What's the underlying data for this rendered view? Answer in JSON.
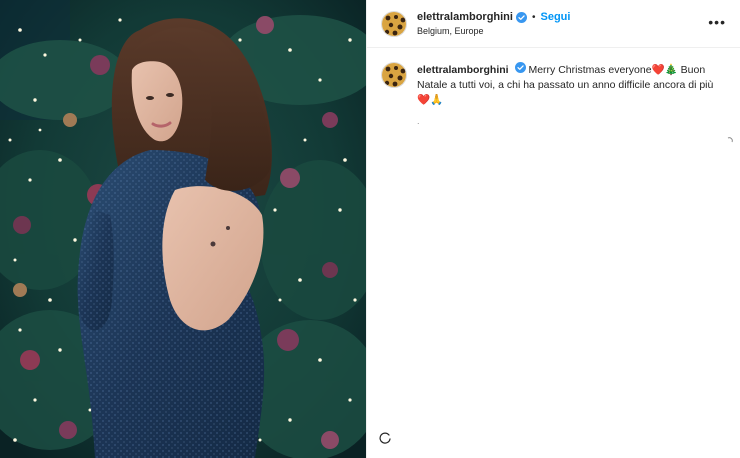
{
  "post": {
    "author": {
      "username": "elettralamborghini",
      "verified": true,
      "avatar_icon": "leopard-avatar-icon"
    },
    "follow_label": "Segui",
    "separator": "•",
    "location": "Belgium, Europe",
    "more_label": "•••",
    "caption": {
      "username": "elettralamborghini",
      "text": "Merry Christmas everyone❤️🎄 Buon Natale a tutti voi, a chi ha passato un anno difficile ancora di più❤️🙏",
      "time": "."
    },
    "photo": {
      "alt": "Woman in sparkly blue open-back dress in front of a Christmas tree"
    }
  },
  "colors": {
    "link_blue": "#0095f6",
    "text": "#262626",
    "muted": "#8e8e8e",
    "border": "#efefef",
    "tree_dark": "#0f2a2a",
    "dress_blue": "#1e3a5f"
  }
}
